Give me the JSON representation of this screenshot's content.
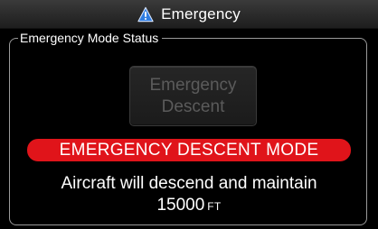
{
  "window": {
    "title": "Emergency",
    "title_icon": "warning-triangle-icon",
    "accent_icon_color": "#2f7de1"
  },
  "status_panel": {
    "label": "Emergency Mode Status",
    "button_line1": "Emergency",
    "button_line2": "Descent",
    "button_state": "disabled",
    "banner_text": "EMERGENCY DESCENT MODE",
    "banner_color": "#e0141a",
    "message_line1": "Aircraft will descend and maintain",
    "altitude_value": "15000",
    "altitude_unit": "FT"
  }
}
